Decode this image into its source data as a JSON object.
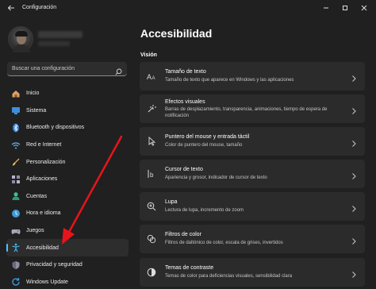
{
  "window": {
    "title": "Configuración",
    "back_icon": "back-arrow-icon",
    "controls": [
      "minimize-icon",
      "maximize-icon",
      "close-icon"
    ]
  },
  "search": {
    "placeholder": "Buscar una configuración",
    "icon": "search-icon"
  },
  "sidebar": {
    "items": [
      {
        "label": "Inicio",
        "icon": "home-icon"
      },
      {
        "label": "Sistema",
        "icon": "system-icon"
      },
      {
        "label": "Bluetooth y dispositivos",
        "icon": "bluetooth-icon"
      },
      {
        "label": "Red e Internet",
        "icon": "wifi-icon"
      },
      {
        "label": "Personalización",
        "icon": "brush-icon"
      },
      {
        "label": "Aplicaciones",
        "icon": "apps-icon"
      },
      {
        "label": "Cuentas",
        "icon": "account-icon"
      },
      {
        "label": "Hora e idioma",
        "icon": "clock-globe-icon"
      },
      {
        "label": "Juegos",
        "icon": "gamepad-icon"
      },
      {
        "label": "Accesibilidad",
        "icon": "accessibility-icon",
        "selected": true
      },
      {
        "label": "Privacidad y seguridad",
        "icon": "shield-icon"
      },
      {
        "label": "Windows Update",
        "icon": "update-icon"
      }
    ]
  },
  "main": {
    "title": "Accesibilidad",
    "section": "Visión",
    "cards": [
      {
        "title": "Tamaño de texto",
        "subtitle": "Tamaño de texto que aparece en Windows y las aplicaciones",
        "icon": "text-size-icon"
      },
      {
        "title": "Efectos visuales",
        "subtitle": "Barras de desplazamiento, transparencia, animaciones, tiempo de espera de notificación",
        "icon": "visual-effects-icon"
      },
      {
        "title": "Puntero del mouse y entrada táctil",
        "subtitle": "Color de puntero del mouse, tamaño",
        "icon": "mouse-pointer-icon"
      },
      {
        "title": "Cursor de texto",
        "subtitle": "Apariencia y grosor, indicador de cursor de texto",
        "icon": "text-cursor-icon"
      },
      {
        "title": "Lupa",
        "subtitle": "Lectura de lupa, incremento de zoom",
        "icon": "magnifier-icon"
      },
      {
        "title": "Filtros de color",
        "subtitle": "Filtros de daltónico de color, escala de grises, invertidos",
        "icon": "color-filter-icon"
      },
      {
        "title": "Temas de contraste",
        "subtitle": "Temas de color para deficiencias visuales, sensibilidad clara",
        "icon": "contrast-icon"
      }
    ]
  },
  "colors": {
    "background": "#202020",
    "card": "#2b2b2b",
    "accent": "#4cc2ff",
    "annotation_arrow": "#e8141b"
  }
}
